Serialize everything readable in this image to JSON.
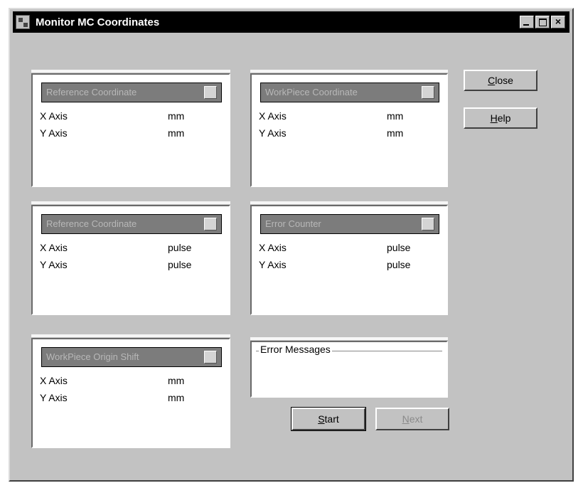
{
  "window": {
    "title": "Monitor MC Coordinates",
    "caption_buttons": {
      "minimize_icon": "minimize-icon",
      "maximize_icon": "maximize-icon",
      "close_glyph": "×"
    }
  },
  "panels": [
    {
      "header": "Reference Coordinate",
      "x_label": "X Axis",
      "x_unit": "mm",
      "y_label": "Y Axis",
      "y_unit": "mm"
    },
    {
      "header": "WorkPiece Coordinate",
      "x_label": "X Axis",
      "x_unit": "mm",
      "y_label": "Y Axis",
      "y_unit": "mm"
    },
    {
      "header": "Reference Coordinate",
      "x_label": "X Axis",
      "x_unit": "pulse",
      "y_label": "Y Axis",
      "y_unit": "pulse"
    },
    {
      "header": "Error Counter",
      "x_label": "X Axis",
      "x_unit": "pulse",
      "y_label": "Y Axis",
      "y_unit": "pulse"
    },
    {
      "header": "WorkPiece Origin Shift",
      "x_label": "X Axis",
      "x_unit": "mm",
      "y_label": "Y Axis",
      "y_unit": "mm"
    }
  ],
  "error_group": {
    "legend": "Error Messages"
  },
  "buttons": {
    "close": {
      "mnemonic": "C",
      "rest": "lose"
    },
    "help": {
      "mnemonic": "H",
      "rest": "elp"
    },
    "start": {
      "mnemonic": "S",
      "rest": "tart"
    },
    "next": {
      "mnemonic": "N",
      "rest": "ext",
      "enabled": false
    }
  }
}
